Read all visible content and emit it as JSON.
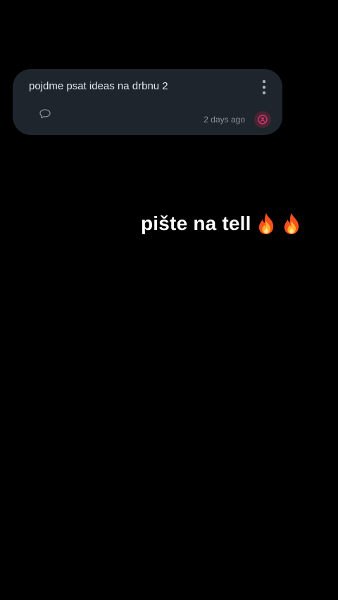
{
  "post": {
    "text": "pojdme psat ideas na drbnu 2",
    "timestamp": "2 days ago",
    "menu_icon": "more-vertical-icon",
    "comment_icon": "comment-icon",
    "avatar_icon": "avatar-icon"
  },
  "overlay": {
    "caption": "pište na tell",
    "emoji": [
      "fire-icon",
      "fire-icon"
    ]
  },
  "colors": {
    "background": "#000000",
    "card": "#1e252d",
    "card_text": "#e3e6ea",
    "muted_text": "#8a9199",
    "avatar_bg": "#4b2433",
    "avatar_accent": "#d2366f",
    "caption_text": "#ffffff"
  }
}
